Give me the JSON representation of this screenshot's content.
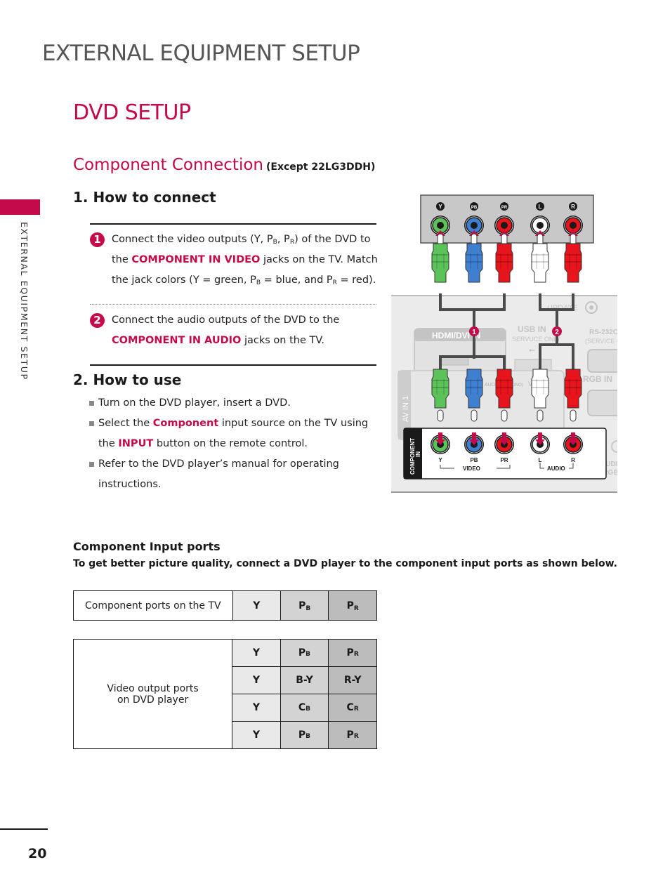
{
  "page_header": "EXTERNAL EQUIPMENT SETUP",
  "side_tab_label": "EXTERNAL EQUIPMENT SETUP",
  "section_title": "DVD SETUP",
  "subsection": {
    "title": "Component Connection",
    "note": "(Except 22LG3DDH)"
  },
  "how_to_connect": {
    "heading": "1. How to connect",
    "steps": [
      {
        "number": "1",
        "t1": "Connect the video outputs (Y, P",
        "s1": "B",
        "t2": ", P",
        "s2": "R",
        "t3": ") of the DVD to the ",
        "highlight": "COMPONENT IN VIDEO",
        "t4": " jacks on the TV. Match the jack colors (Y = green, P",
        "s3": "B",
        "t5": " = blue, and P",
        "s4": "R",
        "t6": " = red)."
      },
      {
        "number": "2",
        "t1": "Connect the audio outputs of the DVD to the ",
        "highlight": "COMPONENT IN AUDIO",
        "t2": " jacks on the TV."
      }
    ]
  },
  "how_to_use": {
    "heading": "2. How to use",
    "items": [
      {
        "text": "Turn on the DVD player, insert a DVD."
      },
      {
        "t1": "Select the ",
        "hl1": "Component",
        "t2": " input source on the TV using the ",
        "hl2": "INPUT",
        "t3": " button on the remote control."
      },
      {
        "text": "Refer to the DVD player’s manual for operating instructions."
      }
    ]
  },
  "diagram": {
    "dvd_jacks": [
      {
        "label": "Y",
        "sub": "",
        "color": "#5cc25a"
      },
      {
        "label": "P",
        "sub": "B",
        "color": "#3f7fd0"
      },
      {
        "label": "P",
        "sub": "R",
        "color": "#e8141c"
      },
      {
        "label": "L",
        "sub": "",
        "color": "#ffffff"
      },
      {
        "label": "R",
        "sub": "",
        "color": "#e8141c"
      }
    ],
    "badge_1": "1",
    "badge_2": "2",
    "update_label": "UPDATE",
    "hdmi_label": "HDMI/DVI IN",
    "usb_label": "USB IN",
    "usb_sub": "SERVUCE ONLY",
    "rs232_label": "RS-232C",
    "rs232_sub": "(SERVICE ONLY)",
    "rgb_label": "RGB IN",
    "av_label": "AV IN 1",
    "av_audio_label": "AUDIO",
    "av_mono_label": "(MONO)",
    "av_video_label": "VIDEO",
    "component_panel_label_1": "COMPONENT",
    "component_panel_label_2": "IN",
    "tv_jack_labels": [
      "Y",
      "PB",
      "PR",
      "L",
      "R"
    ],
    "video_group_label": "VIDEO",
    "audio_group_label": "AUDIO",
    "audio_rgb_label_1": "AUDIO",
    "audio_rgb_label_2": "(RGB)",
    "colors": {
      "accent": "#c40a4a",
      "panel_gray": "#c8c8c8",
      "tv_back": "#ebebeb",
      "cable": "#4a4a4a"
    }
  },
  "component_input_ports": {
    "title": "Component Input ports",
    "description": "To get better picture quality, connect a DVD player to the component input ports as shown below.",
    "tv_table": {
      "label": "Component ports on the TV",
      "cols": [
        {
          "main": "Y",
          "sub": ""
        },
        {
          "main": "P",
          "sub": "B"
        },
        {
          "main": "P",
          "sub": "R"
        }
      ]
    },
    "dvd_table": {
      "label_line1": "Video output ports",
      "label_line2": "on DVD player",
      "rows": [
        [
          {
            "main": "Y",
            "sub": ""
          },
          {
            "main": "P",
            "sub": "B"
          },
          {
            "main": "P",
            "sub": "R"
          }
        ],
        [
          {
            "main": "Y",
            "sub": ""
          },
          {
            "main": "B-Y",
            "sub": ""
          },
          {
            "main": "R-Y",
            "sub": ""
          }
        ],
        [
          {
            "main": "Y",
            "sub": ""
          },
          {
            "main": "C",
            "sub": "B"
          },
          {
            "main": "C",
            "sub": "R"
          }
        ],
        [
          {
            "main": "Y",
            "sub": ""
          },
          {
            "main": "P",
            "sub": "B"
          },
          {
            "main": "P",
            "sub": "R"
          }
        ]
      ]
    }
  },
  "page_number": "20"
}
